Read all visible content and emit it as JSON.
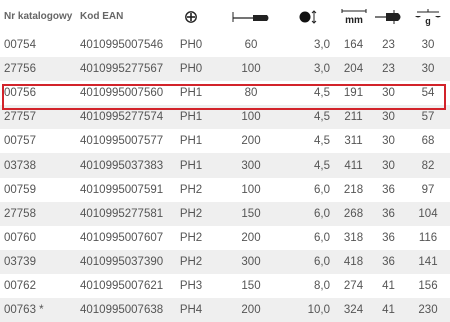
{
  "table": {
    "headers": {
      "catalog_no": "Nr katalogowy",
      "ean": "Kod EAN",
      "tip_icon": "phillips-cross-icon",
      "length_icon": "screwdriver-blade-length-icon",
      "diameter_icon": "blade-diameter-icon",
      "total_length_label": "mm",
      "handle_icon": "handle-diameter-icon",
      "weight_label": "g"
    },
    "rows": [
      {
        "catalog_no": "00754",
        "ean": "4010995007546",
        "tip": "PH0",
        "blade_length": "60",
        "diameter": "3,0",
        "total_length": "164",
        "handle": "23",
        "weight": "30"
      },
      {
        "catalog_no": "27756",
        "ean": "4010995277567",
        "tip": "PH0",
        "blade_length": "100",
        "diameter": "3,0",
        "total_length": "204",
        "handle": "23",
        "weight": "30"
      },
      {
        "catalog_no": "00756",
        "ean": "4010995007560",
        "tip": "PH1",
        "blade_length": "80",
        "diameter": "4,5",
        "total_length": "191",
        "handle": "30",
        "weight": "54"
      },
      {
        "catalog_no": "27757",
        "ean": "4010995277574",
        "tip": "PH1",
        "blade_length": "100",
        "diameter": "4,5",
        "total_length": "211",
        "handle": "30",
        "weight": "57"
      },
      {
        "catalog_no": "00757",
        "ean": "4010995007577",
        "tip": "PH1",
        "blade_length": "200",
        "diameter": "4,5",
        "total_length": "311",
        "handle": "30",
        "weight": "68"
      },
      {
        "catalog_no": "03738",
        "ean": "4010995037383",
        "tip": "PH1",
        "blade_length": "300",
        "diameter": "4,5",
        "total_length": "411",
        "handle": "30",
        "weight": "82"
      },
      {
        "catalog_no": "00759",
        "ean": "4010995007591",
        "tip": "PH2",
        "blade_length": "100",
        "diameter": "6,0",
        "total_length": "218",
        "handle": "36",
        "weight": "97"
      },
      {
        "catalog_no": "27758",
        "ean": "4010995277581",
        "tip": "PH2",
        "blade_length": "150",
        "diameter": "6,0",
        "total_length": "268",
        "handle": "36",
        "weight": "104"
      },
      {
        "catalog_no": "00760",
        "ean": "4010995007607",
        "tip": "PH2",
        "blade_length": "200",
        "diameter": "6,0",
        "total_length": "318",
        "handle": "36",
        "weight": "116"
      },
      {
        "catalog_no": "03739",
        "ean": "4010995037390",
        "tip": "PH2",
        "blade_length": "300",
        "diameter": "6,0",
        "total_length": "418",
        "handle": "36",
        "weight": "141"
      },
      {
        "catalog_no": "00762",
        "ean": "4010995007621",
        "tip": "PH3",
        "blade_length": "150",
        "diameter": "8,0",
        "total_length": "274",
        "handle": "41",
        "weight": "156"
      },
      {
        "catalog_no": "00763 *",
        "ean": "4010995007638",
        "tip": "PH4",
        "blade_length": "200",
        "diameter": "10,0",
        "total_length": "324",
        "handle": "41",
        "weight": "230"
      }
    ],
    "highlighted_catalog_no": "00756",
    "colors": {
      "highlight_border": "#d2232a",
      "alt_row_background": "#efefef",
      "text": "#555555"
    }
  }
}
